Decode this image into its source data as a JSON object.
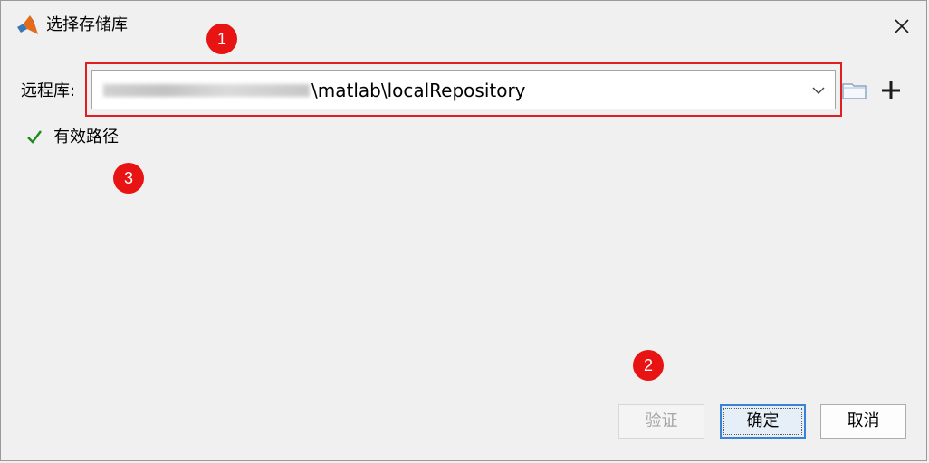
{
  "window": {
    "title": "选择存储库",
    "icons": {
      "app": "matlab-icon",
      "close": "close-icon"
    }
  },
  "repository": {
    "label": "远程库:",
    "path_visible": "\\matlab\\localRepository",
    "icons": {
      "dropdown": "chevron-down-icon",
      "browse": "folder-icon",
      "add": "plus-icon"
    }
  },
  "status": {
    "text": "有效路径",
    "icon": "checkmark-icon",
    "color": "#1f8a1f"
  },
  "buttons": {
    "validate": "验证",
    "ok": "确定",
    "cancel": "取消"
  },
  "annotations": {
    "marker1": "1",
    "marker2": "2",
    "marker3": "3",
    "color": "#e81313"
  }
}
